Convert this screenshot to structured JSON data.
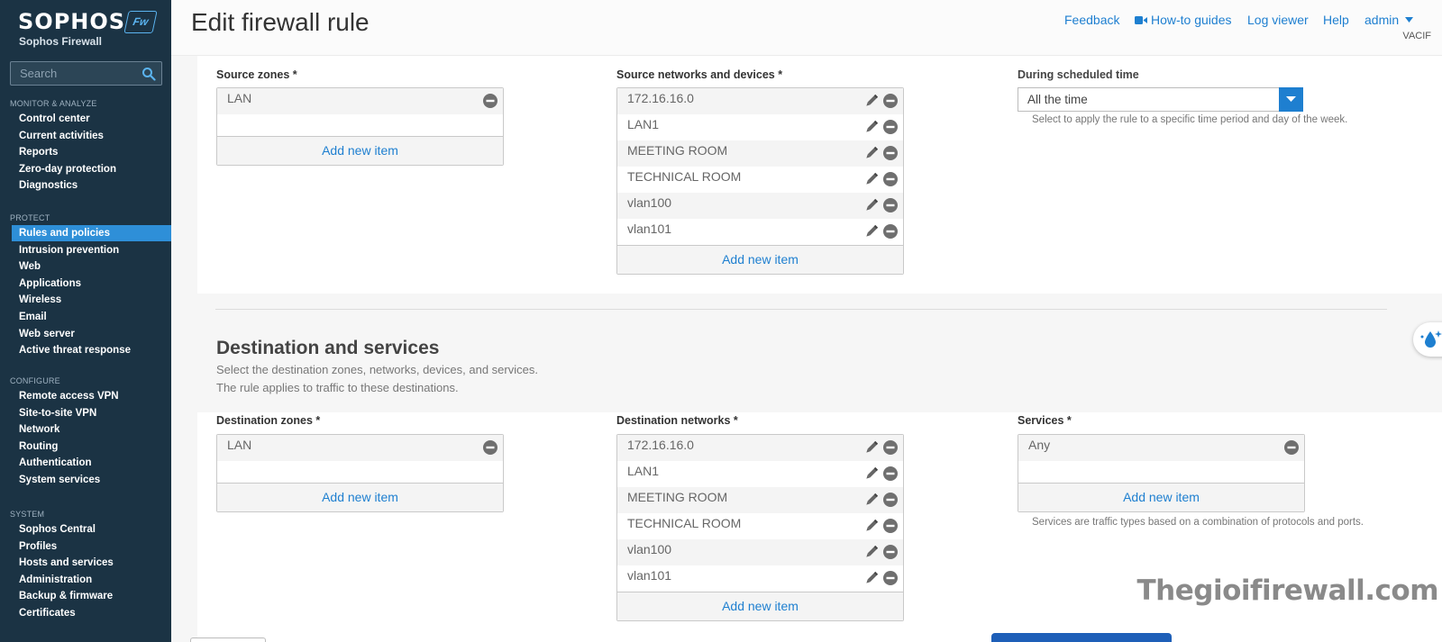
{
  "app": {
    "brand": "SOPHOS",
    "brand_badge": "Fw",
    "product": "Sophos Firewall"
  },
  "sidebar": {
    "search_placeholder": "Search",
    "sections": [
      {
        "title": "MONITOR & ANALYZE",
        "items": [
          "Control center",
          "Current activities",
          "Reports",
          "Zero-day protection",
          "Diagnostics"
        ]
      },
      {
        "title": "PROTECT",
        "items": [
          "Rules and policies",
          "Intrusion prevention",
          "Web",
          "Applications",
          "Wireless",
          "Email",
          "Web server",
          "Active threat response"
        ]
      },
      {
        "title": "CONFIGURE",
        "items": [
          "Remote access VPN",
          "Site-to-site VPN",
          "Network",
          "Routing",
          "Authentication",
          "System services"
        ]
      },
      {
        "title": "SYSTEM",
        "items": [
          "Sophos Central",
          "Profiles",
          "Hosts and services",
          "Administration",
          "Backup & firmware",
          "Certificates"
        ]
      }
    ],
    "active_item": "Rules and policies"
  },
  "header": {
    "title": "Edit firewall rule",
    "links": {
      "feedback": "Feedback",
      "how_to": "How-to guides",
      "log_viewer": "Log viewer",
      "help": "Help",
      "user": "admin"
    },
    "org": "VACIF"
  },
  "source": {
    "zones_label": "Source zones *",
    "zones": [
      "LAN"
    ],
    "networks_label": "Source networks and devices *",
    "networks": [
      "172.16.16.0",
      "LAN1",
      "MEETING ROOM",
      "TECHNICAL ROOM",
      "vlan100",
      "vlan101"
    ],
    "schedule_label": "During scheduled time",
    "schedule_value": "All the time",
    "schedule_help": "Select to apply the rule to a specific time period and day of the week."
  },
  "destination": {
    "title": "Destination and services",
    "desc_line1": "Select the destination zones, networks, devices, and services.",
    "desc_line2": "The rule applies to traffic to these destinations.",
    "zones_label": "Destination zones *",
    "zones": [
      "LAN"
    ],
    "networks_label": "Destination networks *",
    "networks": [
      "172.16.16.0",
      "LAN1",
      "MEETING ROOM",
      "TECHNICAL ROOM",
      "vlan100",
      "vlan101"
    ],
    "services_label": "Services *",
    "services": [
      "Any"
    ],
    "services_help": "Services are traffic types based on a combination of protocols and ports."
  },
  "common": {
    "add_new_item": "Add new item"
  },
  "watermark": "Thegioifirewall.com",
  "colors": {
    "sidebar_bg": "#1b3344",
    "accent": "#1e7fd0",
    "active_nav": "#2e8fd8"
  }
}
